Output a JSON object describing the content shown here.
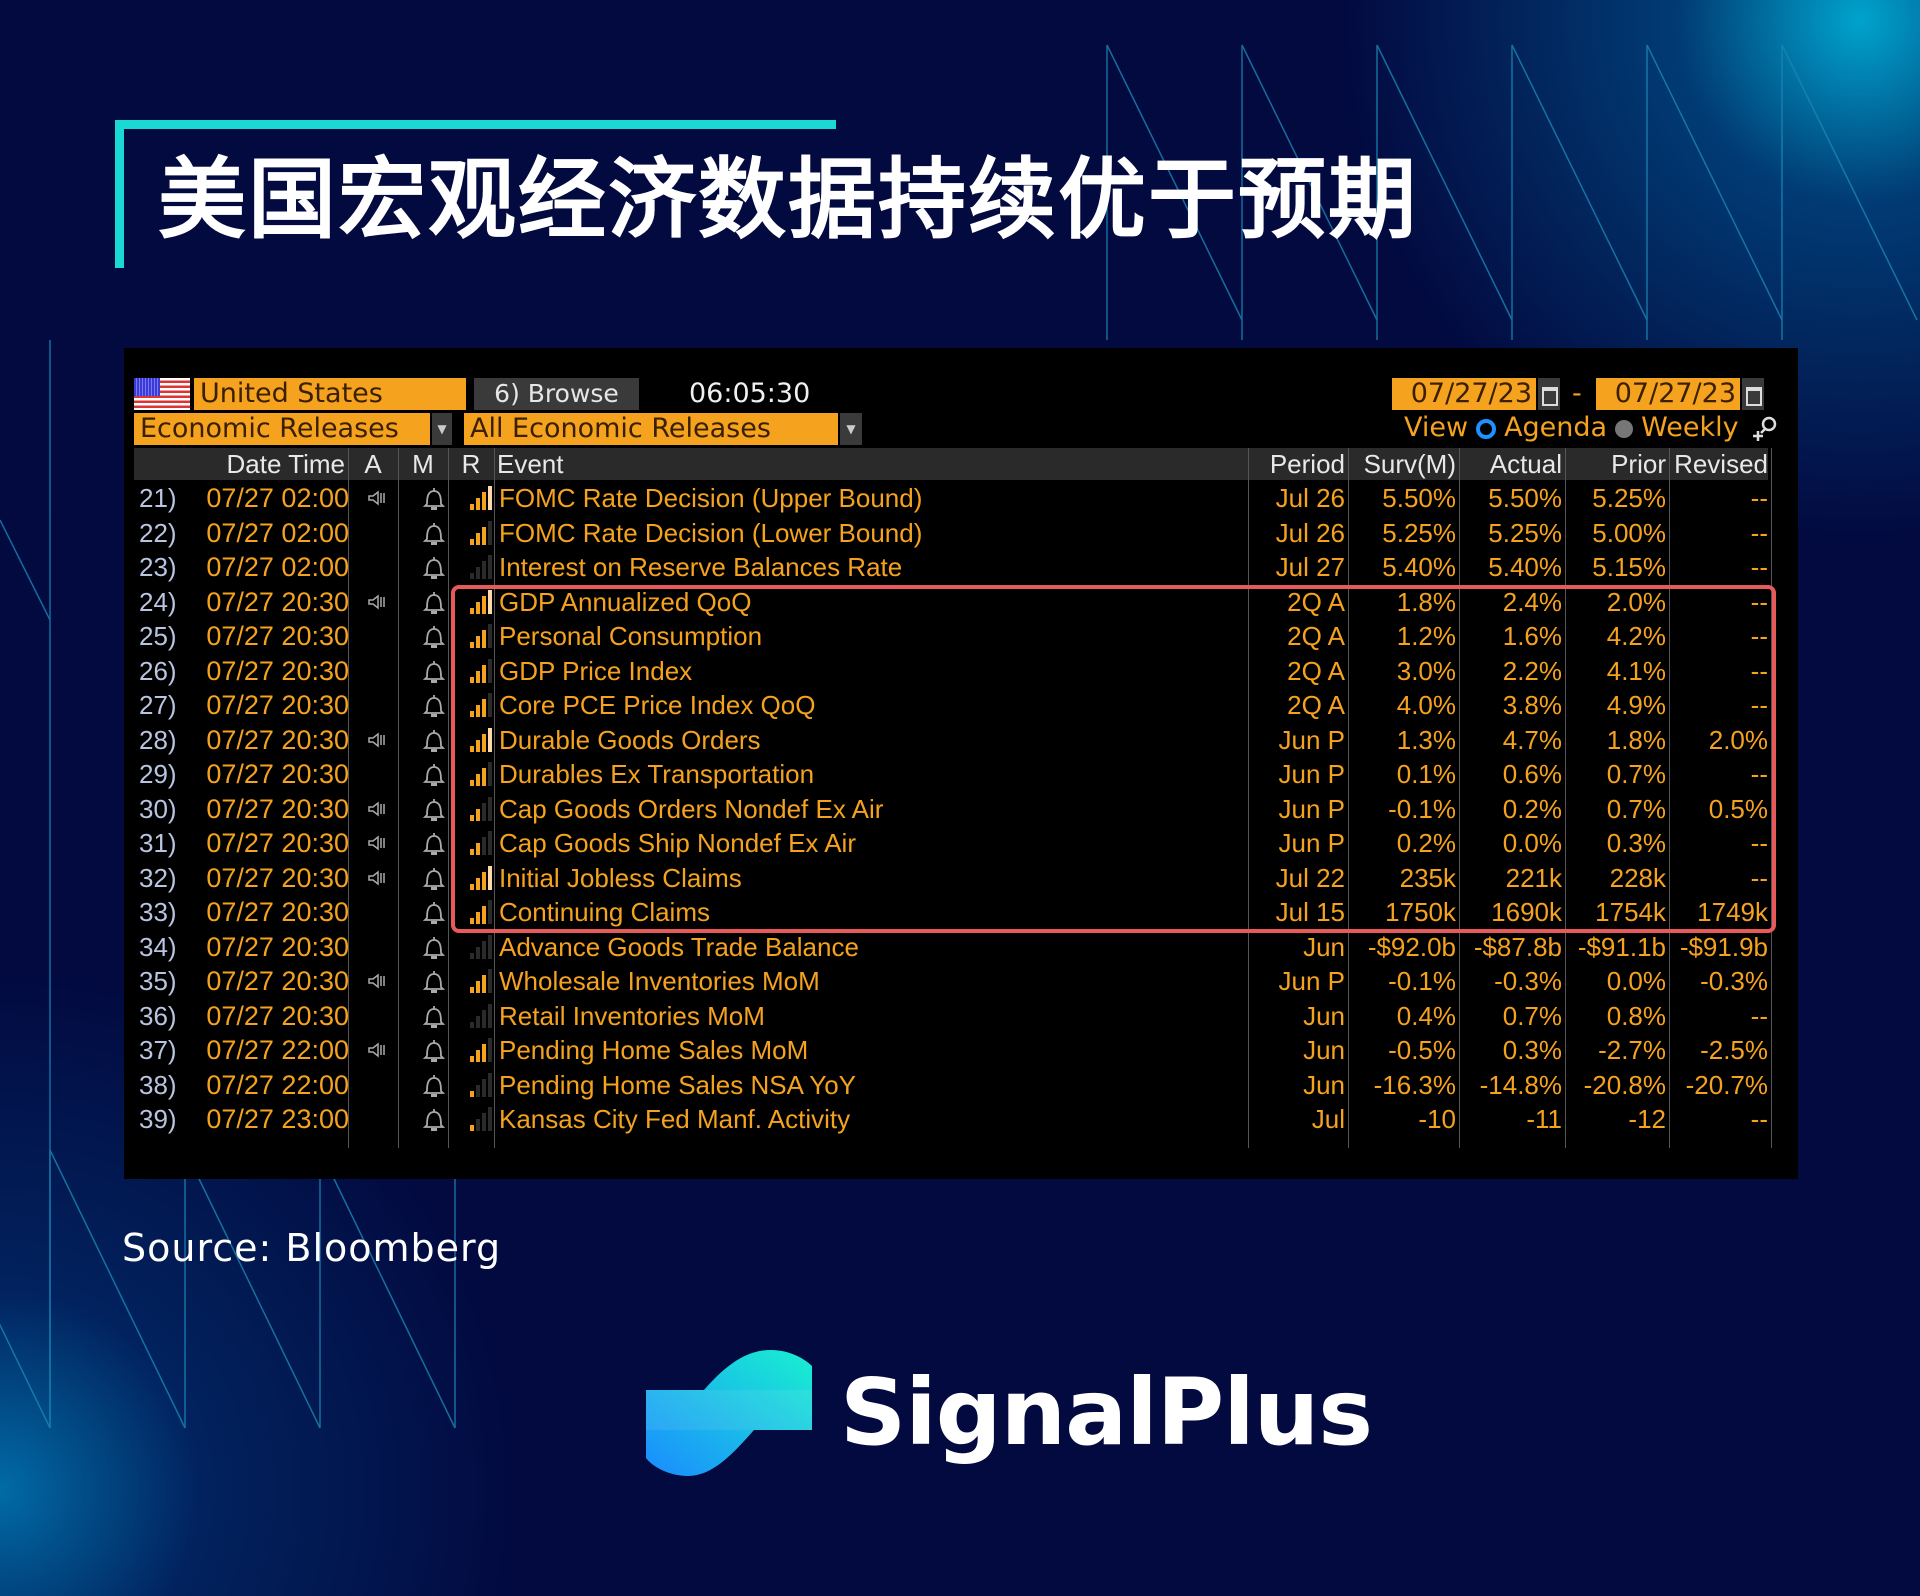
{
  "title": "美国宏观经济数据持续优于预期",
  "source": "Source: Bloomberg",
  "brand": "SignalPlus",
  "terminal": {
    "country": "United States",
    "browse_label": "6) Browse",
    "clock": "06:05:30",
    "category": "Economic Releases",
    "filter": "All Economic Releases",
    "date_from": "07/27/23",
    "date_sep": "-",
    "date_to": "07/27/23",
    "view_label": "View",
    "view_options": [
      "Agenda",
      "Weekly"
    ],
    "view_selected": "Agenda",
    "columns": [
      "Date Time",
      "A",
      "M",
      "R",
      "Event",
      "Period",
      "Surv(M)",
      "Actual",
      "Prior",
      "Revised"
    ],
    "highlight_color": "#e85a5a",
    "rows": [
      {
        "n": "21)",
        "dt": "07/27 02:00",
        "alert": true,
        "rel": 4,
        "event": "FOMC Rate Decision (Upper Bound)",
        "period": "Jul 26",
        "surv": "5.50%",
        "actual": "5.50%",
        "prior": "5.25%",
        "revised": "--"
      },
      {
        "n": "22)",
        "dt": "07/27 02:00",
        "alert": false,
        "rel": 3,
        "event": "FOMC Rate Decision (Lower Bound)",
        "period": "Jul 26",
        "surv": "5.25%",
        "actual": "5.25%",
        "prior": "5.00%",
        "revised": "--"
      },
      {
        "n": "23)",
        "dt": "07/27 02:00",
        "alert": false,
        "rel": 0,
        "event": "Interest on Reserve Balances Rate",
        "period": "Jul 27",
        "surv": "5.40%",
        "actual": "5.40%",
        "prior": "5.15%",
        "revised": "--"
      },
      {
        "n": "24)",
        "dt": "07/27 20:30",
        "alert": true,
        "rel": 4,
        "event": "GDP Annualized QoQ",
        "period": "2Q A",
        "surv": "1.8%",
        "actual": "2.4%",
        "prior": "2.0%",
        "revised": "--"
      },
      {
        "n": "25)",
        "dt": "07/27 20:30",
        "alert": false,
        "rel": 3,
        "event": "Personal Consumption",
        "period": "2Q A",
        "surv": "1.2%",
        "actual": "1.6%",
        "prior": "4.2%",
        "revised": "--"
      },
      {
        "n": "26)",
        "dt": "07/27 20:30",
        "alert": false,
        "rel": 3,
        "event": "GDP Price Index",
        "period": "2Q A",
        "surv": "3.0%",
        "actual": "2.2%",
        "prior": "4.1%",
        "revised": "--"
      },
      {
        "n": "27)",
        "dt": "07/27 20:30",
        "alert": false,
        "rel": 3,
        "event": "Core PCE Price Index QoQ",
        "period": "2Q A",
        "surv": "4.0%",
        "actual": "3.8%",
        "prior": "4.9%",
        "revised": "--"
      },
      {
        "n": "28)",
        "dt": "07/27 20:30",
        "alert": true,
        "rel": 4,
        "event": "Durable Goods Orders",
        "period": "Jun P",
        "surv": "1.3%",
        "actual": "4.7%",
        "prior": "1.8%",
        "revised": "2.0%"
      },
      {
        "n": "29)",
        "dt": "07/27 20:30",
        "alert": false,
        "rel": 3,
        "event": "Durables Ex Transportation",
        "period": "Jun P",
        "surv": "0.1%",
        "actual": "0.6%",
        "prior": "0.7%",
        "revised": "--"
      },
      {
        "n": "30)",
        "dt": "07/27 20:30",
        "alert": true,
        "rel": 2,
        "event": "Cap Goods Orders Nondef Ex Air",
        "period": "Jun P",
        "surv": "-0.1%",
        "actual": "0.2%",
        "prior": "0.7%",
        "revised": "0.5%"
      },
      {
        "n": "31)",
        "dt": "07/27 20:30",
        "alert": true,
        "rel": 2,
        "event": "Cap Goods Ship Nondef Ex Air",
        "period": "Jun P",
        "surv": "0.2%",
        "actual": "0.0%",
        "prior": "0.3%",
        "revised": "--"
      },
      {
        "n": "32)",
        "dt": "07/27 20:30",
        "alert": true,
        "rel": 4,
        "event": "Initial Jobless Claims",
        "period": "Jul 22",
        "surv": "235k",
        "actual": "221k",
        "prior": "228k",
        "revised": "--"
      },
      {
        "n": "33)",
        "dt": "07/27 20:30",
        "alert": false,
        "rel": 3,
        "event": "Continuing Claims",
        "period": "Jul 15",
        "surv": "1750k",
        "actual": "1690k",
        "prior": "1754k",
        "revised": "1749k"
      },
      {
        "n": "34)",
        "dt": "07/27 20:30",
        "alert": false,
        "rel": 0,
        "event": "Advance Goods Trade Balance",
        "period": "Jun",
        "surv": "-$92.0b",
        "actual": "-$87.8b",
        "prior": "-$91.1b",
        "revised": "-$91.9b"
      },
      {
        "n": "35)",
        "dt": "07/27 20:30",
        "alert": true,
        "rel": 3,
        "event": "Wholesale Inventories MoM",
        "period": "Jun P",
        "surv": "-0.1%",
        "actual": "-0.3%",
        "prior": "0.0%",
        "revised": "-0.3%"
      },
      {
        "n": "36)",
        "dt": "07/27 20:30",
        "alert": false,
        "rel": 0,
        "event": "Retail Inventories MoM",
        "period": "Jun",
        "surv": "0.4%",
        "actual": "0.7%",
        "prior": "0.8%",
        "revised": "--"
      },
      {
        "n": "37)",
        "dt": "07/27 22:00",
        "alert": true,
        "rel": 3,
        "event": "Pending Home Sales MoM",
        "period": "Jun",
        "surv": "-0.5%",
        "actual": "0.3%",
        "prior": "-2.7%",
        "revised": "-2.5%"
      },
      {
        "n": "38)",
        "dt": "07/27 22:00",
        "alert": false,
        "rel": 1,
        "event": "Pending Home Sales NSA YoY",
        "period": "Jun",
        "surv": "-16.3%",
        "actual": "-14.8%",
        "prior": "-20.8%",
        "revised": "-20.7%"
      },
      {
        "n": "39)",
        "dt": "07/27 23:00",
        "alert": false,
        "rel": 1,
        "event": "Kansas City Fed Manf. Activity",
        "period": "Jul",
        "surv": "-10",
        "actual": "-11",
        "prior": "-12",
        "revised": "--"
      }
    ],
    "highlighted_rows": [
      "24)",
      "33)"
    ]
  }
}
